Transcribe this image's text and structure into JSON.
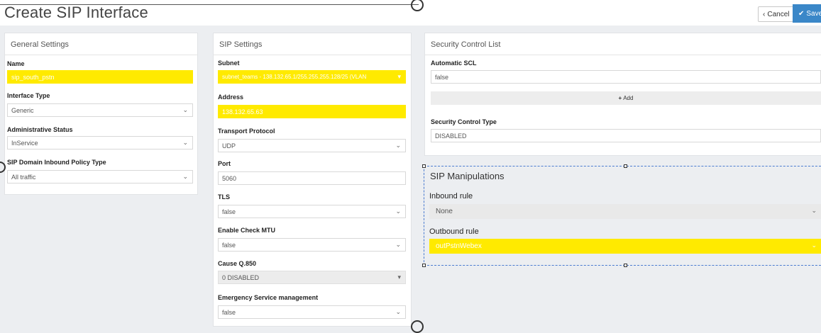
{
  "header": {
    "title": "Create SIP Interface",
    "cancel_label": "Cancel",
    "save_label": "Save"
  },
  "general": {
    "title": "General Settings",
    "name_label": "Name",
    "name_value": "sip_south_pstn",
    "interface_type_label": "Interface Type",
    "interface_type_value": "Generic",
    "admin_status_label": "Administrative Status",
    "admin_status_value": "InService",
    "inbound_policy_label": "SIP Domain Inbound Policy Type",
    "inbound_policy_value": "All traffic"
  },
  "sip": {
    "title": "SIP Settings",
    "subnet_label": "Subnet",
    "subnet_value": "subnet_teams - 138.132.65.1/255.255.255.128/25 (VLAN",
    "address_label": "Address",
    "address_value": "138.132.65.63",
    "transport_label": "Transport Protocol",
    "transport_value": "UDP",
    "port_label": "Port",
    "port_value": "5060",
    "tls_label": "TLS",
    "tls_value": "false",
    "mtu_label": "Enable Check MTU",
    "mtu_value": "false",
    "cause_label": "Cause Q.850",
    "cause_value": "0 DISABLED",
    "emergency_label": "Emergency Service management",
    "emergency_value": "false"
  },
  "security": {
    "title": "Security Control List",
    "auto_scl_label": "Automatic SCL",
    "auto_scl_value": "false",
    "add_label": "Add",
    "type_label": "Security Control Type",
    "type_value": "DISABLED"
  },
  "manipulations": {
    "title": "SIP Manipulations",
    "inbound_label": "Inbound rule",
    "inbound_value": "None",
    "outbound_label": "Outbound rule",
    "outbound_value": "outPstnWebex"
  },
  "icons": {
    "caret": "chevron-down-icon",
    "plus": "plus-icon",
    "check": "check-icon",
    "back": "chevron-left-icon"
  },
  "colors": {
    "highlight": "#ffea00",
    "save_button": "#3a87c8",
    "selection_border": "#4a7bd0"
  }
}
